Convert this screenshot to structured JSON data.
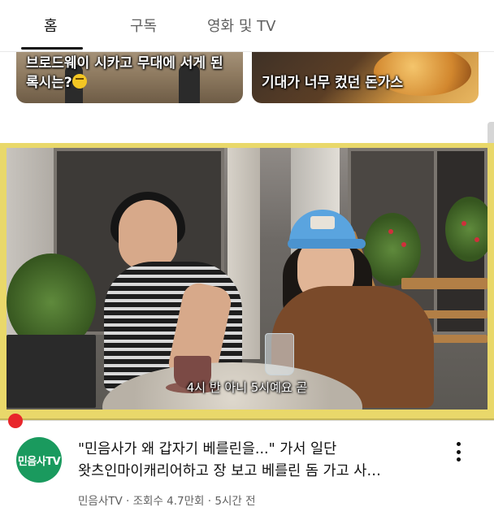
{
  "tabs": [
    {
      "label": "홈",
      "active": true
    },
    {
      "label": "구독",
      "active": false
    },
    {
      "label": "영화 및 TV",
      "active": false
    }
  ],
  "shorts": [
    {
      "caption_line1": "브로드웨이 시카고 무대에 서게 된",
      "caption_line2": "록시는?",
      "emoji": "thinking-face-emoji"
    },
    {
      "caption_line1": "기대가 너무 컸던 돈가스"
    }
  ],
  "video": {
    "subtitle": "4시 반 아니 5시예요 곧",
    "progress": 0.02,
    "frame_color": "#e9d86a"
  },
  "channel": {
    "avatar_text": "민음사TV",
    "avatar_color": "#1a9a5e"
  },
  "video_info": {
    "title": "\"민음사가 왜 갑자기 베를린을...\" 가서 일단\n왓츠인마이캐리어하고 장 보고 베를린 돔 가고 사…",
    "meta": "민음사TV · 조회수 4.7만회 · 5시간 전"
  },
  "colors": {
    "accent_red": "#e8262b",
    "text_primary": "#0f0f0f",
    "text_secondary": "#606060"
  }
}
